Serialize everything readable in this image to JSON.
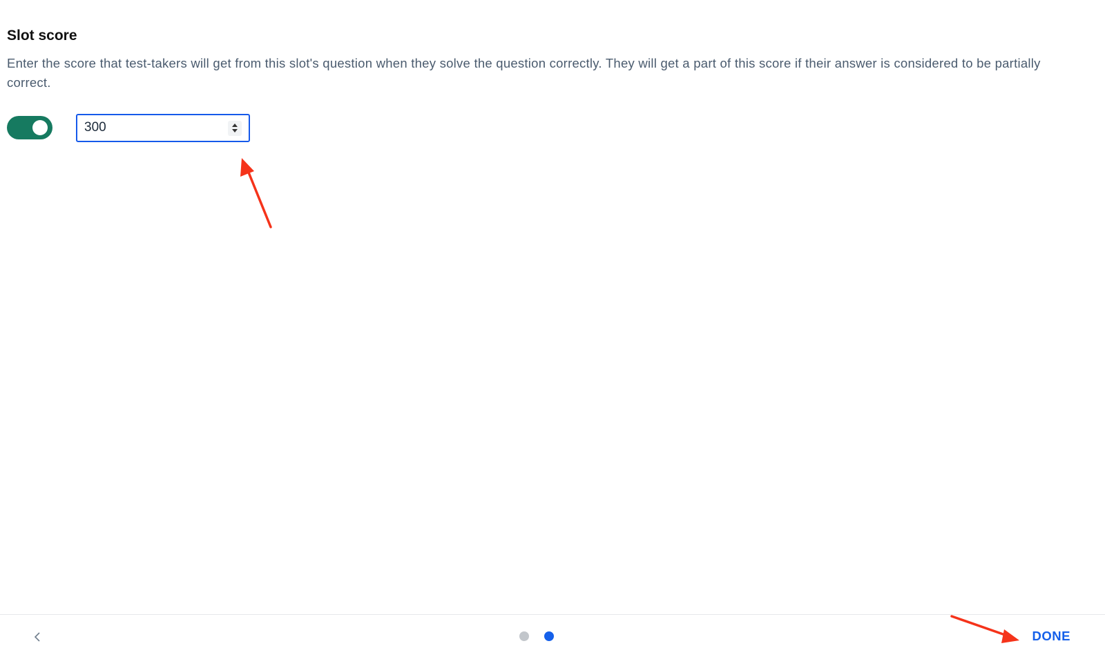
{
  "section": {
    "title": "Slot score",
    "description": "Enter the score that test-takers will get from this slot's question when they solve the question correctly. They will get a part of this score if their answer is considered to be partially correct."
  },
  "score": {
    "enabled": true,
    "value": "300"
  },
  "footer": {
    "done_label": "DONE",
    "steps_total": 2,
    "current_step": 2
  },
  "colors": {
    "toggle_on": "#167a60",
    "accent": "#1560ea",
    "annotation_arrow": "#f5331a",
    "text_muted": "#4a5b6e"
  }
}
